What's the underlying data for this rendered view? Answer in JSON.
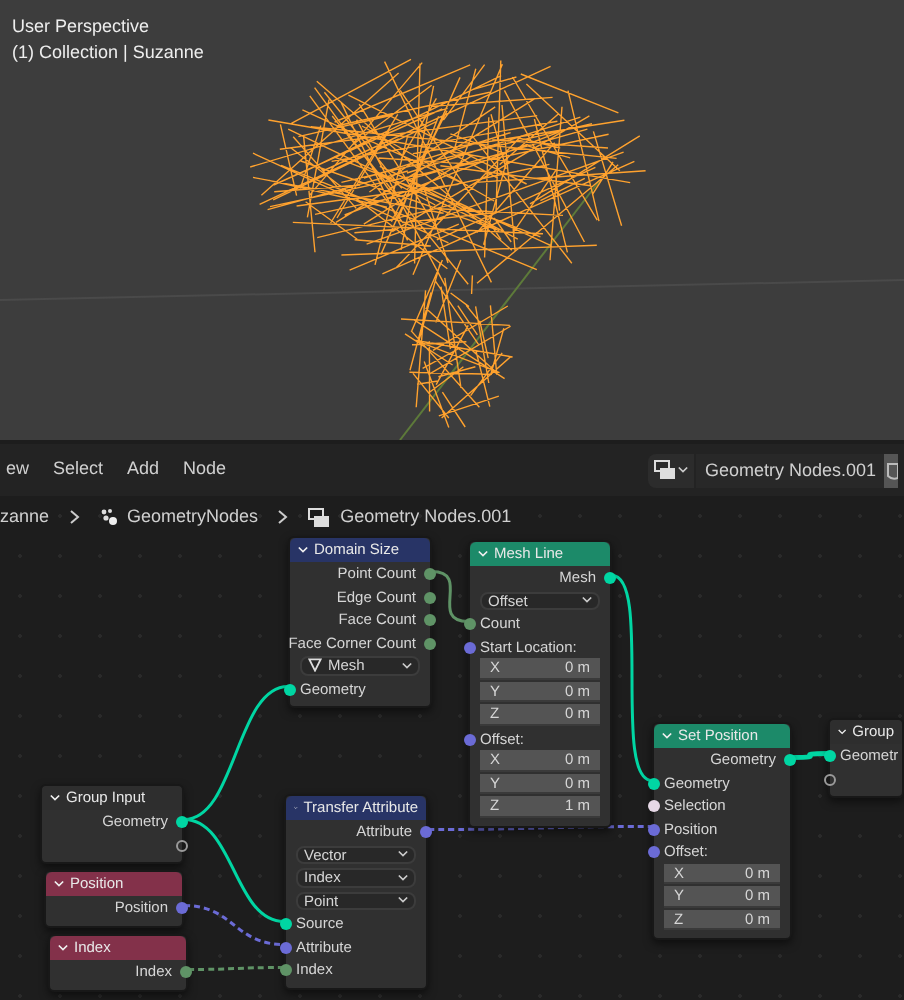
{
  "viewport": {
    "lines": [
      "User Perspective",
      "(1) Collection | Suzanne"
    ]
  },
  "header": {
    "menus": [
      "ew",
      "Select",
      "Add",
      "Node"
    ],
    "node_tree": "Geometry Nodes.001"
  },
  "breadcrumbs": [
    {
      "label": "zanne",
      "kind": "object"
    },
    {
      "label": "GeometryNodes",
      "kind": "modifier"
    },
    {
      "label": "Geometry Nodes.001",
      "kind": "node_tree"
    }
  ],
  "nodes": [
    {
      "title": "Domain Size",
      "kind": "attribute",
      "rows": [
        {
          "kind": "output",
          "label": "Point Count",
          "color": "#5f9366"
        },
        {
          "kind": "output",
          "label": "Edge Count",
          "color": "#5f9366"
        },
        {
          "kind": "output",
          "label": "Face Count",
          "color": "#5f9366"
        },
        {
          "kind": "output",
          "label": "Face Corner Count",
          "color": "#5f9366"
        },
        {
          "kind": "domain_select",
          "label": "Mesh"
        },
        {
          "kind": "input",
          "label": "Geometry",
          "color": "#00d6a3"
        }
      ]
    },
    {
      "title": "Mesh Line",
      "kind": "geometry",
      "rows": [
        {
          "kind": "output",
          "label": "Mesh",
          "color": "#00d6a3"
        },
        {
          "kind": "select",
          "label": "Offset"
        },
        {
          "kind": "input",
          "label": "Count",
          "color": "#5f9366"
        },
        {
          "kind": "input",
          "label": "Start Location:",
          "color": "#6b6bd6"
        },
        {
          "kind": "value",
          "axis": "X",
          "value": "0 m"
        },
        {
          "kind": "value",
          "axis": "Y",
          "value": "0 m"
        },
        {
          "kind": "value",
          "axis": "Z",
          "value": "0 m"
        },
        {
          "kind": "input",
          "label": "Offset:",
          "color": "#6b6bd6"
        },
        {
          "kind": "value",
          "axis": "X",
          "value": "0 m"
        },
        {
          "kind": "value",
          "axis": "Y",
          "value": "0 m"
        },
        {
          "kind": "value",
          "axis": "Z",
          "value": "1 m"
        }
      ]
    },
    {
      "title": "Set Position",
      "kind": "geometry",
      "rows": [
        {
          "kind": "output",
          "label": "Geometry",
          "color": "#00d6a3"
        },
        {
          "kind": "input",
          "label": "Geometry",
          "color": "#00d6a3"
        },
        {
          "kind": "input",
          "label": "Selection",
          "color": "#e6d8e6"
        },
        {
          "kind": "input",
          "label": "Position",
          "color": "#6b6bd6"
        },
        {
          "kind": "input",
          "label": "Offset:",
          "color": "#6b6bd6"
        },
        {
          "kind": "value",
          "axis": "X",
          "value": "0 m"
        },
        {
          "kind": "value",
          "axis": "Y",
          "value": "0 m"
        },
        {
          "kind": "value",
          "axis": "Z",
          "value": "0 m"
        }
      ]
    },
    {
      "title": "Group",
      "kind": "group",
      "rows": [
        {
          "kind": "input",
          "label": "Geometr",
          "color": "#00d6a3"
        },
        {
          "kind": "input"
        }
      ]
    },
    {
      "title": "Group Input",
      "kind": "group",
      "rows": [
        {
          "kind": "output",
          "label": "Geometry",
          "color": "#00d6a3"
        },
        {
          "kind": "output"
        }
      ]
    },
    {
      "title": "Transfer Attribute",
      "kind": "attribute",
      "rows": [
        {
          "kind": "output",
          "label": "Attribute",
          "color": "#6b6bd6"
        },
        {
          "kind": "select",
          "label": "Vector"
        },
        {
          "kind": "select",
          "label": "Index"
        },
        {
          "kind": "select",
          "label": "Point"
        },
        {
          "kind": "input",
          "label": "Source",
          "color": "#00d6a3"
        },
        {
          "kind": "input",
          "label": "Attribute",
          "color": "#6b6bd6"
        },
        {
          "kind": "input",
          "label": "Index",
          "color": "#5f9366"
        }
      ]
    },
    {
      "title": "Position",
      "kind": "input",
      "rows": [
        {
          "kind": "output",
          "label": "Position",
          "color": "#6b6bd6"
        }
      ]
    },
    {
      "title": "Index",
      "kind": "input",
      "rows": [
        {
          "kind": "output",
          "label": "Index",
          "color": "#5f9366"
        }
      ]
    }
  ]
}
